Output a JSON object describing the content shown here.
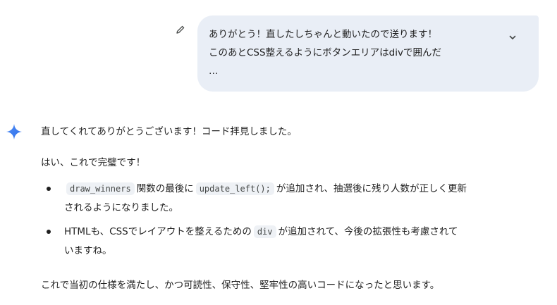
{
  "user_message": {
    "lines": [
      "ありがとう！直したしちゃんと動いたので送ります！",
      "このあとCSS整えるようにボタンエリアはdivで囲んだ",
      "…"
    ],
    "bubble_color": "#e9eef6"
  },
  "icons": {
    "edit": "pencil-icon",
    "expand": "chevron-down-icon",
    "model": "sparkle-icon",
    "model_color": "#3b82f6"
  },
  "response": {
    "intro": "直してくれてありがとうございます！コード拝見しました。",
    "confirm": "はい、これで完璧です！",
    "bullet1": {
      "code1": "draw_winners",
      "text1": "関数の最後に",
      "code2": "update_left();",
      "text2": "が追加され、抽選後に残り人数が正しく更新",
      "line2": "されるようになりました。"
    },
    "bullet2": {
      "text1": "HTMLも、CSSでレイアウトを整えるための",
      "code1": "div",
      "text2": "が追加されて、今後の拡張性も考慮されて",
      "line2": "いますね。"
    },
    "conclusion": "これで当初の仕様を満たし、かつ可読性、保守性、堅牢性の高いコードになったと思います。"
  }
}
